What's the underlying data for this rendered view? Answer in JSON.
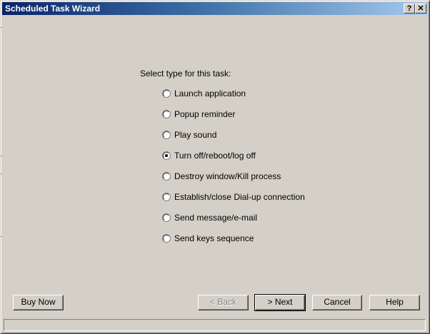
{
  "window": {
    "title": "Scheduled Task Wizard",
    "help_button": "?",
    "close_button": "✕"
  },
  "prompt": "Select type for this task:",
  "options": [
    {
      "label": "Launch application",
      "selected": false
    },
    {
      "label": "Popup reminder",
      "selected": false
    },
    {
      "label": "Play sound",
      "selected": false
    },
    {
      "label": "Turn off/reboot/log off",
      "selected": true
    },
    {
      "label": "Destroy window/Kill process",
      "selected": false
    },
    {
      "label": "Establish/close Dial-up connection",
      "selected": false
    },
    {
      "label": "Send message/e-mail",
      "selected": false
    },
    {
      "label": "Send keys sequence",
      "selected": false
    }
  ],
  "buttons": {
    "buy_now": "Buy Now",
    "back": "< Back",
    "next": "> Next",
    "cancel": "Cancel",
    "help": "Help"
  },
  "status": ""
}
